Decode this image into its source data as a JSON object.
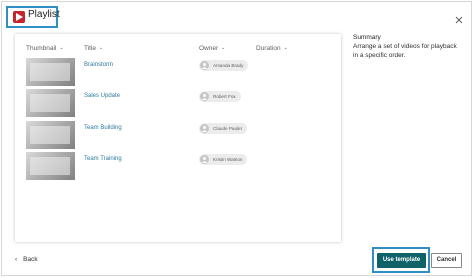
{
  "dialog": {
    "title": "Playlist",
    "close_icon": "close-icon",
    "app_icon": "play-icon"
  },
  "colors": {
    "accent": "#0f6368",
    "highlight": "#2f8fc5",
    "app_icon": "#c4262e",
    "link": "#2f7a9e"
  },
  "table": {
    "headers": [
      "Thumbnail",
      "Title",
      "Owner",
      "Duration"
    ],
    "rows": [
      {
        "title": "Brainstorm",
        "owner": "Amanda Brady"
      },
      {
        "title": "Sales Update",
        "owner": "Robert Fox"
      },
      {
        "title": "Team Building",
        "owner": "Claude Paulet"
      },
      {
        "title": "Team Training",
        "owner": "Kristin Watson"
      }
    ]
  },
  "summary": {
    "title": "Summary",
    "text": "Arrange a set of videos for playback in a specific order."
  },
  "footer": {
    "back_label": "Back",
    "use_template_label": "Use template",
    "cancel_label": "Cancel"
  }
}
